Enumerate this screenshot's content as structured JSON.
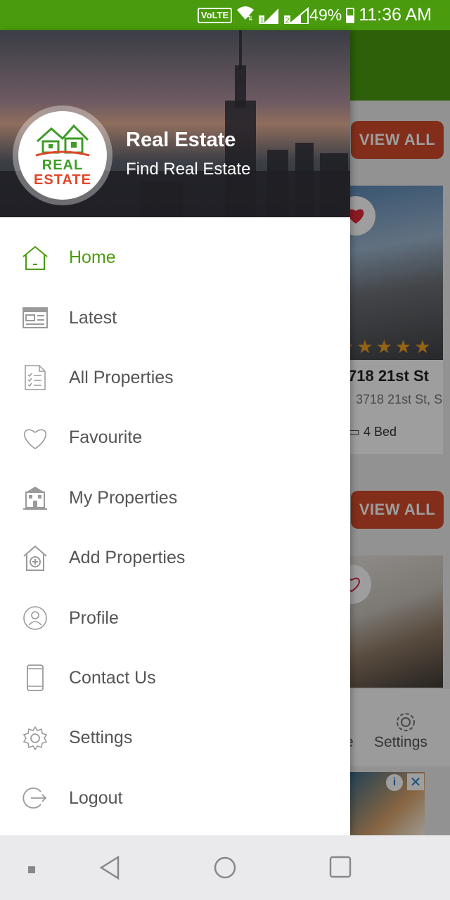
{
  "status_bar": {
    "volte": "VoLTE",
    "sim1": "1",
    "sim2": "2",
    "battery": "49%",
    "time": "11:36 AM"
  },
  "background": {
    "view_all_1": "VIEW ALL",
    "view_all_2": "VIEW ALL",
    "property_title": "718 21st St",
    "property_address": "3718 21st St, S",
    "bed": "4 Bed",
    "nav_settings": "Settings",
    "nav_partial": "e",
    "rating_stars": "★★★★★"
  },
  "drawer": {
    "logo_line1": "REAL",
    "logo_line2": "ESTATE",
    "title": "Real Estate",
    "subtitle": "Find Real Estate",
    "items": [
      {
        "label": "Home",
        "icon": "home-icon",
        "active": true
      },
      {
        "label": "Latest",
        "icon": "newspaper-icon"
      },
      {
        "label": "All Properties",
        "icon": "document-list-icon"
      },
      {
        "label": "Favourite",
        "icon": "heart-icon"
      },
      {
        "label": "My Properties",
        "icon": "building-icon"
      },
      {
        "label": "Add Properties",
        "icon": "add-house-icon"
      },
      {
        "label": "Profile",
        "icon": "profile-icon"
      },
      {
        "label": "Contact Us",
        "icon": "phone-icon"
      },
      {
        "label": "Settings",
        "icon": "gear-icon"
      },
      {
        "label": "Logout",
        "icon": "logout-icon"
      }
    ]
  },
  "colors": {
    "accent": "#4a9c0e",
    "button": "#d24b2a",
    "menu_text": "#555555",
    "icon_gray": "#9a9a9a"
  }
}
